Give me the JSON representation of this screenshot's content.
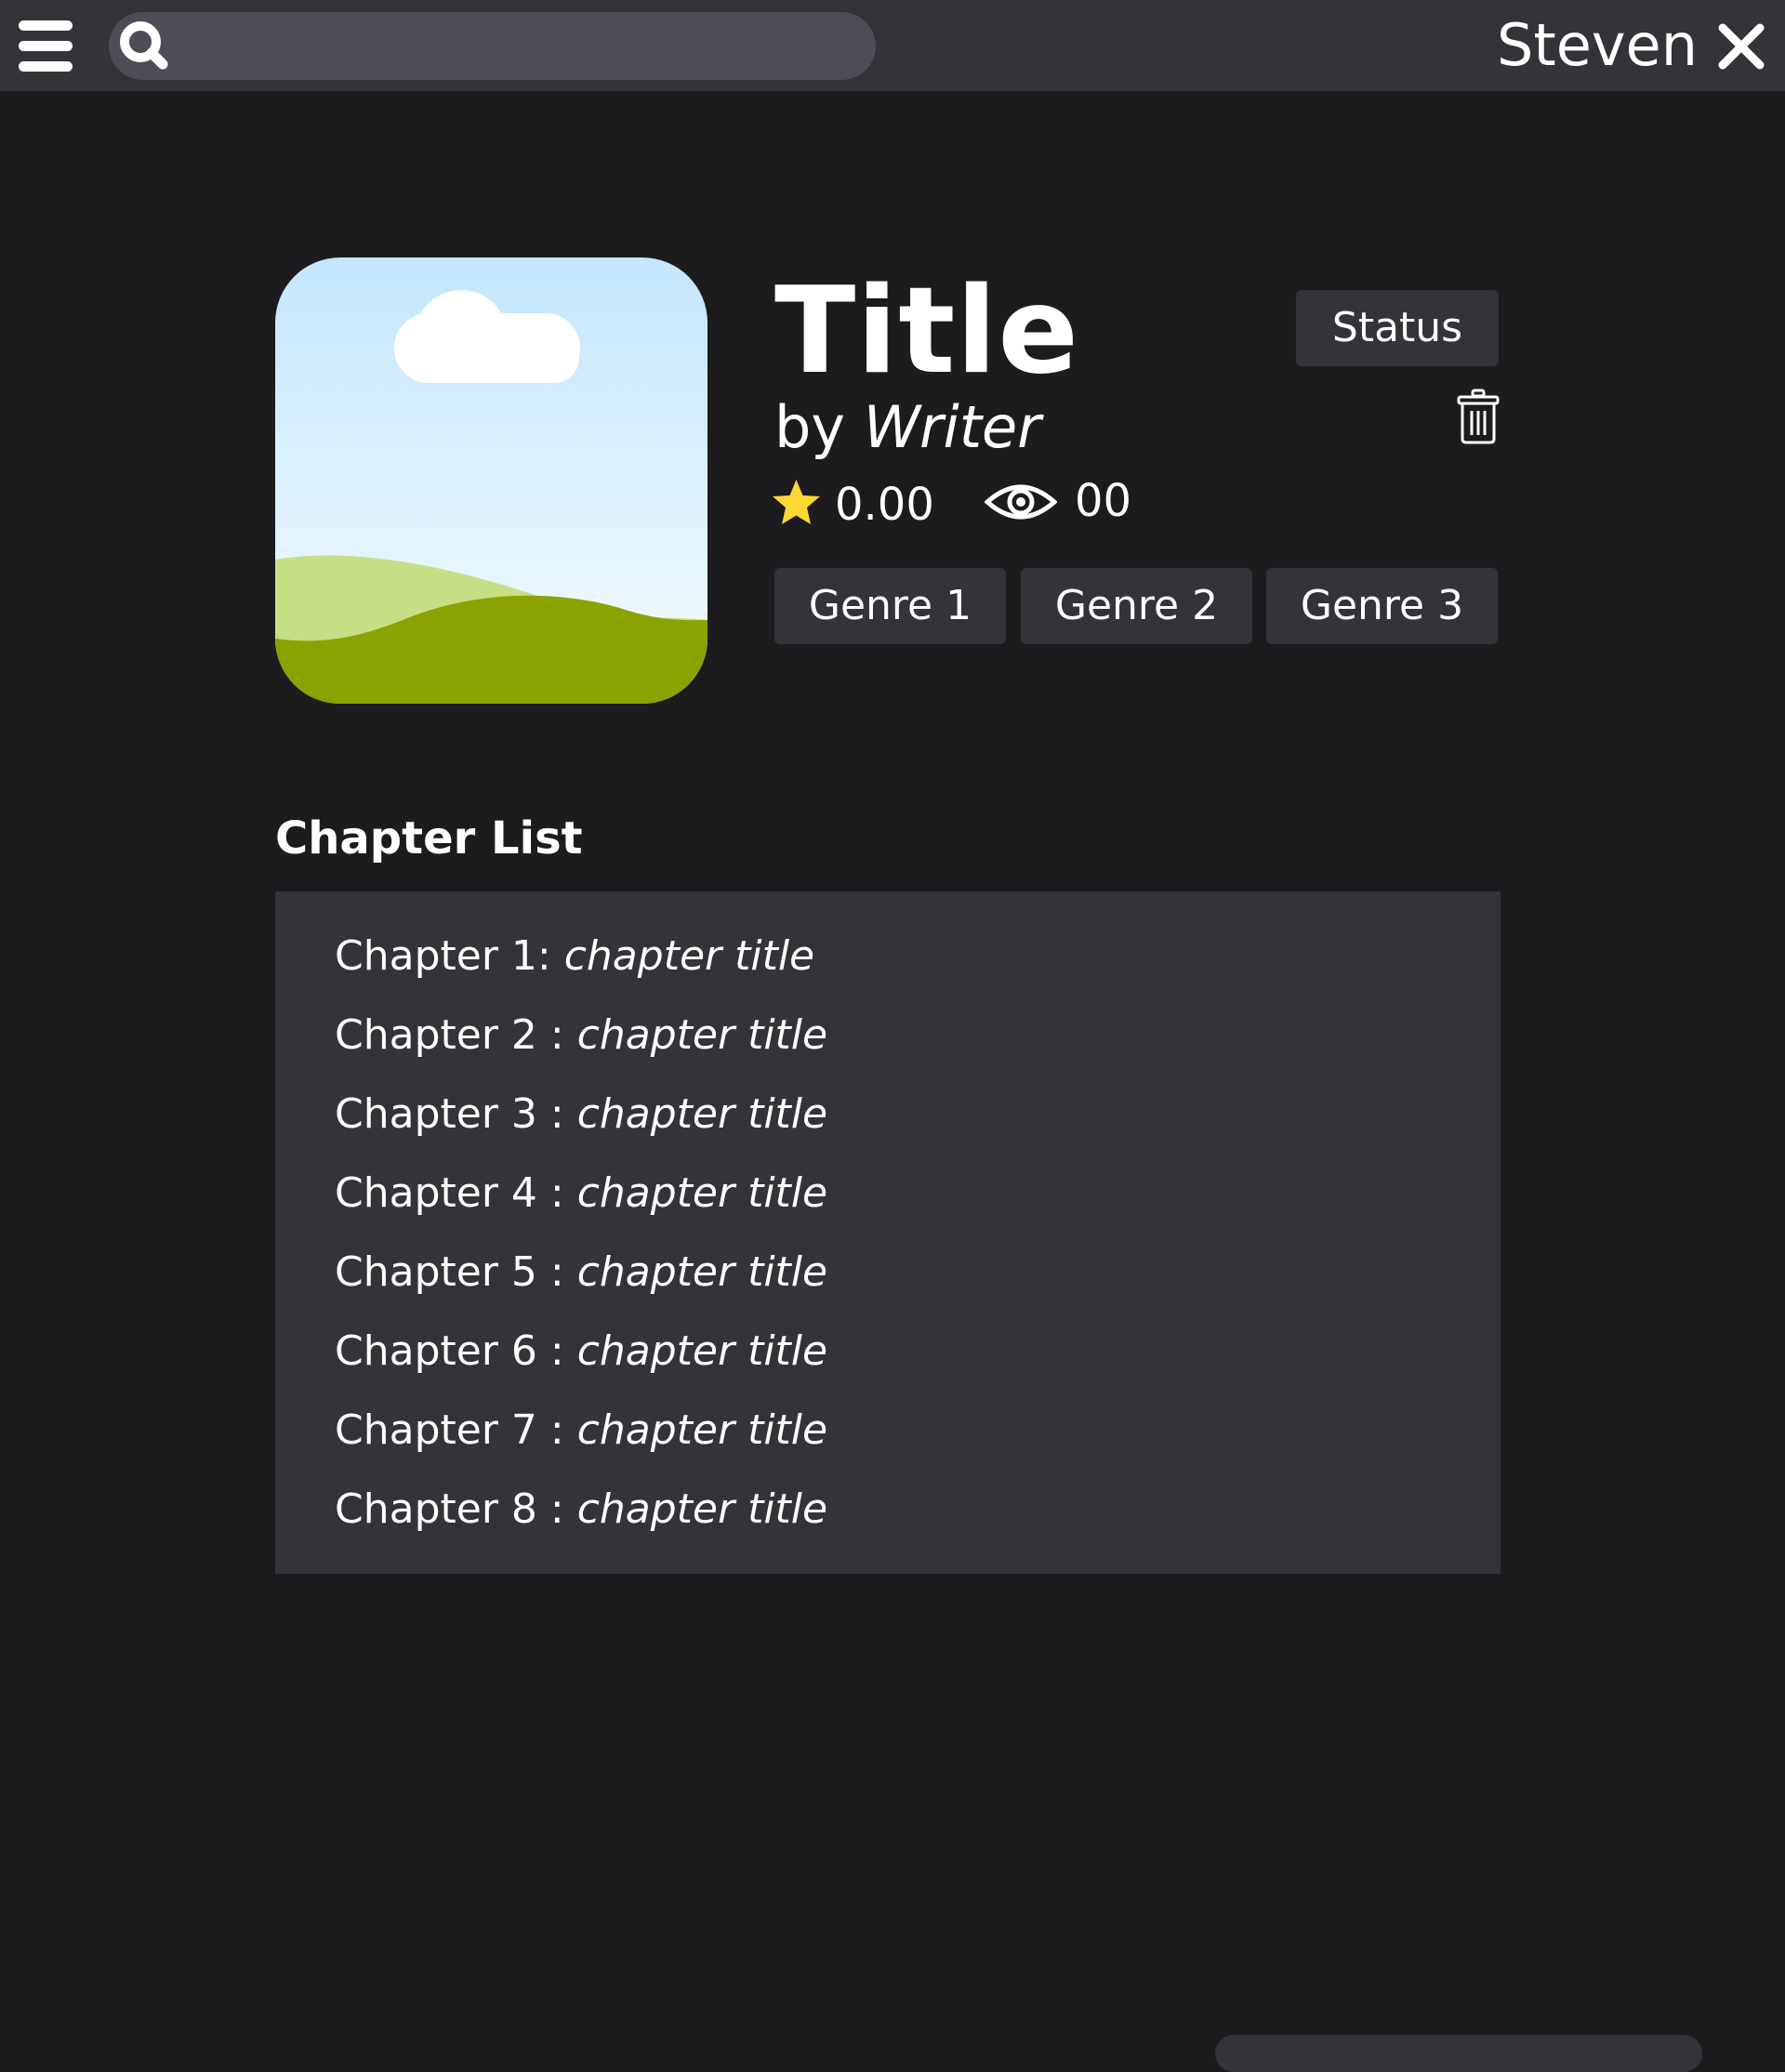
{
  "topbar": {
    "menu_icon": "hamburger-menu-icon",
    "search": {
      "icon": "search-icon",
      "placeholder": "",
      "value": ""
    },
    "user_name": "Steven",
    "close_icon": "close-icon"
  },
  "book": {
    "cover_icon": "image-placeholder-icon",
    "title": "Title",
    "by_label": "by",
    "writer": "Writer",
    "status_label": "Status",
    "delete_icon": "trash-icon",
    "rating": "0.00",
    "rating_icon": "star-icon",
    "views": "00",
    "views_icon": "eye-icon",
    "genres": [
      "Genre 1",
      "Genre 2",
      "Genre 3"
    ]
  },
  "chapters": {
    "heading": "Chapter List",
    "items": [
      {
        "label": "Chapter 1: ",
        "title": "chapter title"
      },
      {
        "label": "Chapter 2 : ",
        "title": "chapter title"
      },
      {
        "label": "Chapter 3 : ",
        "title": "chapter title"
      },
      {
        "label": "Chapter 4 : ",
        "title": "chapter title"
      },
      {
        "label": "Chapter 5 : ",
        "title": "chapter title"
      },
      {
        "label": "Chapter 6 : ",
        "title": "chapter title"
      },
      {
        "label": "Chapter 7 : ",
        "title": "chapter title"
      },
      {
        "label": "Chapter 8 : ",
        "title": "chapter title"
      }
    ]
  },
  "colors": {
    "background": "#1c1c1f",
    "surface": "#333338",
    "search_field": "#4d4d57",
    "star": "#fdd835",
    "text": "#ffffff"
  }
}
